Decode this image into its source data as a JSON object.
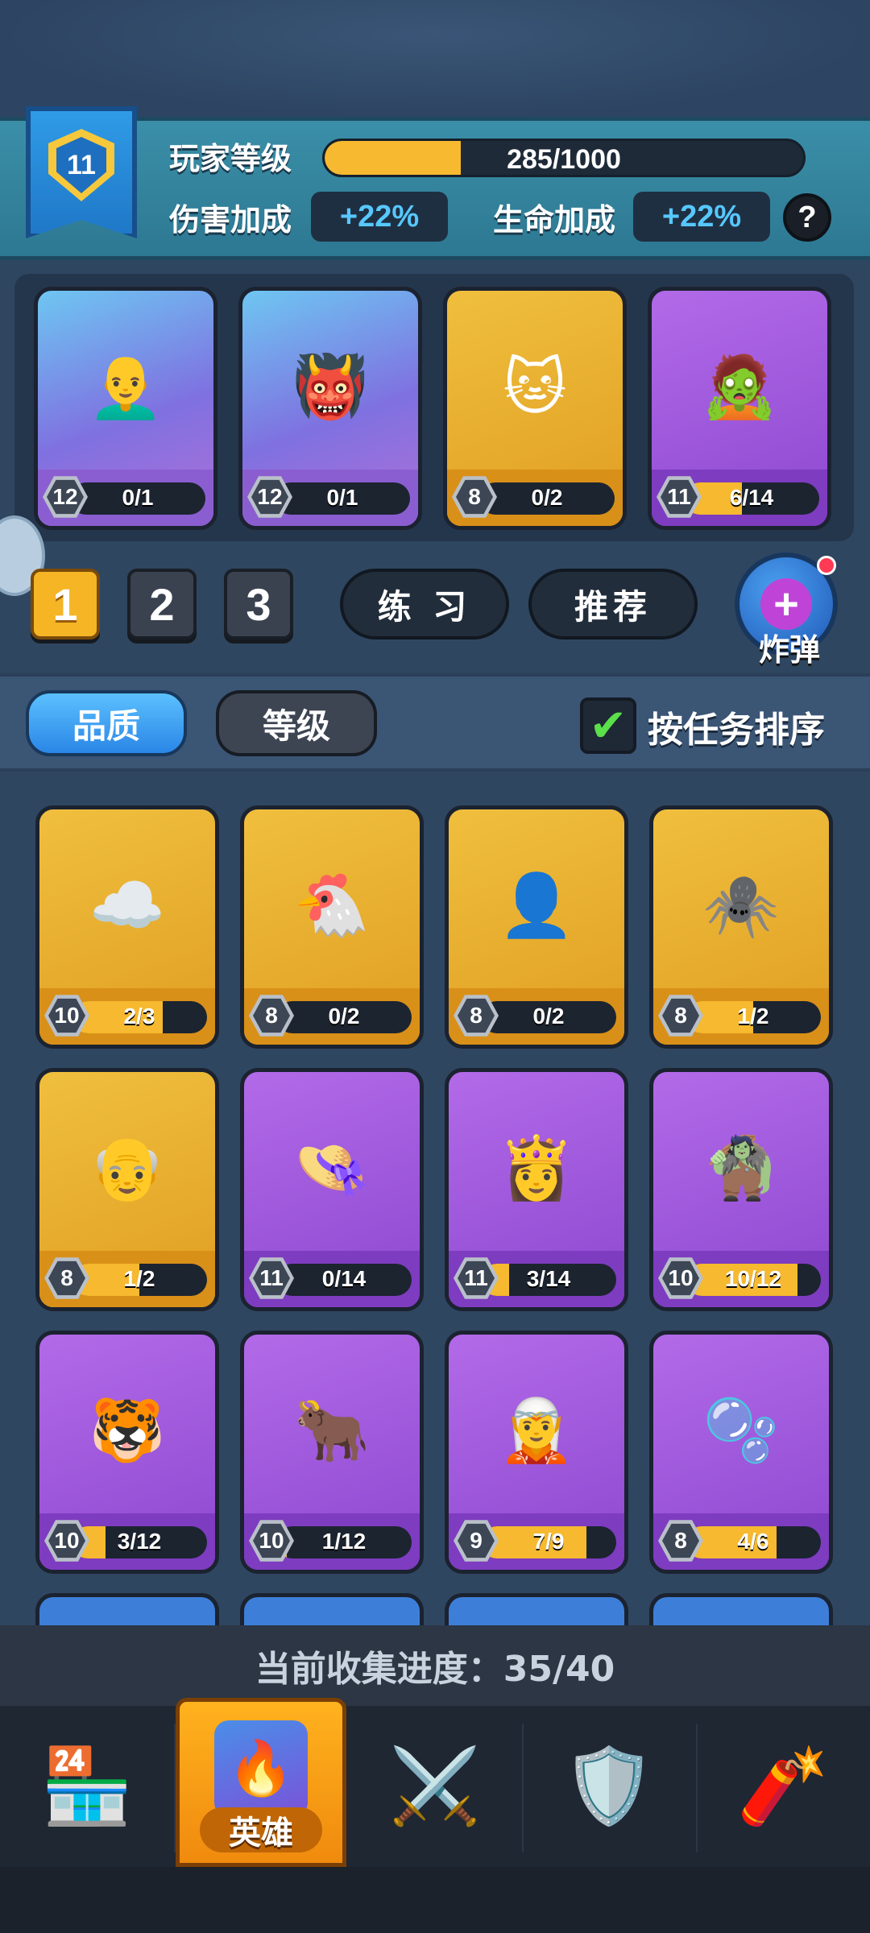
{
  "player": {
    "level": "11",
    "level_label": "玩家等级",
    "xp_text": "285/1000",
    "xp_fraction": 0.285,
    "damage_label": "伤害加成",
    "damage_value": "+22%",
    "hp_label": "生命加成",
    "hp_value": "+22%",
    "help": "?"
  },
  "deck": [
    {
      "level": "12",
      "progress": "0/1",
      "fraction": 0,
      "rarity": "blue",
      "icon": "👨‍🦲"
    },
    {
      "level": "12",
      "progress": "0/1",
      "fraction": 0,
      "rarity": "blue",
      "icon": "👹"
    },
    {
      "level": "8",
      "progress": "0/2",
      "fraction": 0,
      "rarity": "gold",
      "icon": "🐱"
    },
    {
      "level": "11",
      "progress": "6/14",
      "fraction": 0.43,
      "rarity": "purple",
      "icon": "🧟"
    }
  ],
  "deck_tabs": [
    "1",
    "2",
    "3"
  ],
  "actions": {
    "practice": "练 习",
    "recommend": "推荐",
    "bomb": "炸弹",
    "bomb_icon": "+"
  },
  "sort": {
    "quality": "品质",
    "level": "等级",
    "task_sort": "按任务排序",
    "check": "✔"
  },
  "heroes": [
    {
      "level": "10",
      "progress": "2/3",
      "fraction": 0.67,
      "rarity": "gold",
      "icon": "☁️"
    },
    {
      "level": "8",
      "progress": "0/2",
      "fraction": 0,
      "rarity": "gold",
      "icon": "🐔"
    },
    {
      "level": "8",
      "progress": "0/2",
      "fraction": 0,
      "rarity": "gold",
      "icon": "👤"
    },
    {
      "level": "8",
      "progress": "1/2",
      "fraction": 0.5,
      "rarity": "gold",
      "icon": "🕷️"
    },
    {
      "level": "8",
      "progress": "1/2",
      "fraction": 0.5,
      "rarity": "gold",
      "icon": "👴"
    },
    {
      "level": "11",
      "progress": "0/14",
      "fraction": 0,
      "rarity": "purple",
      "icon": "👒"
    },
    {
      "level": "11",
      "progress": "3/14",
      "fraction": 0.21,
      "rarity": "purple",
      "icon": "👸"
    },
    {
      "level": "10",
      "progress": "10/12",
      "fraction": 0.83,
      "rarity": "purple",
      "icon": "🧌"
    },
    {
      "level": "10",
      "progress": "3/12",
      "fraction": 0.25,
      "rarity": "purple",
      "icon": "🐯"
    },
    {
      "level": "10",
      "progress": "1/12",
      "fraction": 0.08,
      "rarity": "purple",
      "icon": "🐂"
    },
    {
      "level": "9",
      "progress": "7/9",
      "fraction": 0.78,
      "rarity": "purple",
      "icon": "🧝"
    },
    {
      "level": "8",
      "progress": "4/6",
      "fraction": 0.67,
      "rarity": "purple",
      "icon": "🫧"
    }
  ],
  "collection_progress": "当前收集进度：35/40",
  "nav": [
    {
      "name": "shop",
      "icon": "🏪"
    },
    {
      "name": "heroes",
      "icon": "🔥",
      "label": "英雄"
    },
    {
      "name": "battle",
      "icon": "⚔️"
    },
    {
      "name": "clan",
      "icon": "🛡️"
    },
    {
      "name": "events",
      "icon": "🧨"
    }
  ]
}
